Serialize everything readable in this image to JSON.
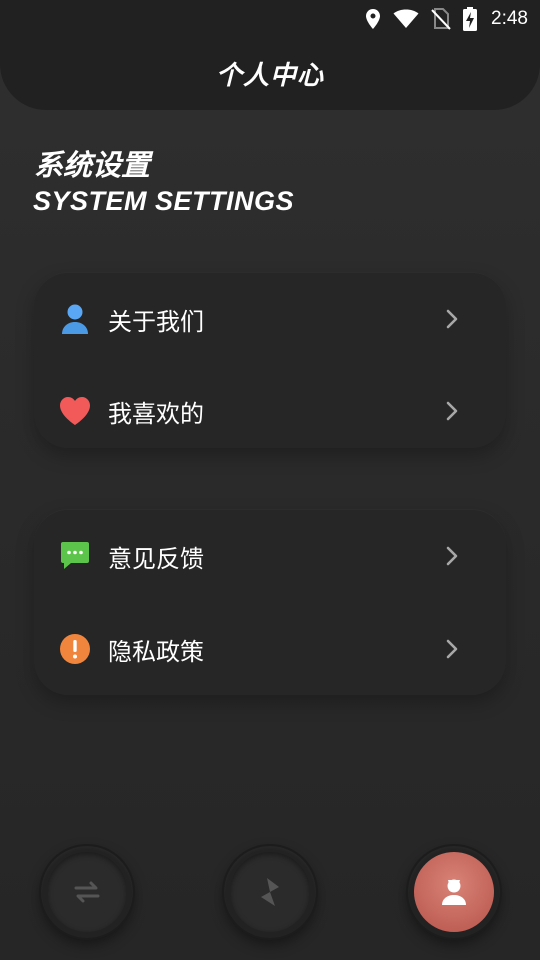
{
  "status_bar": {
    "time": "2:48",
    "icons": [
      "location-icon",
      "wifi-icon",
      "no-sim-icon",
      "battery-charging-icon"
    ]
  },
  "header": {
    "title": "个人中心"
  },
  "section": {
    "title_cn": "系统设置",
    "title_en": "SYSTEM SETTINGS"
  },
  "group1": [
    {
      "label": "关于我们",
      "icon": "user-icon",
      "color": "#5aa8f5"
    },
    {
      "label": "我喜欢的",
      "icon": "heart-icon",
      "color": "#f25a5a"
    }
  ],
  "group2": [
    {
      "label": "意见反馈",
      "icon": "chat-icon",
      "color": "#5cc44a"
    },
    {
      "label": "隐私政策",
      "icon": "warning-icon",
      "color": "#f0853e"
    }
  ],
  "bottom_nav": [
    {
      "icon": "swap-icon",
      "active": false
    },
    {
      "icon": "lightning-icon",
      "active": false
    },
    {
      "icon": "profile-icon",
      "active": true
    }
  ],
  "colors": {
    "accent": "#c96a5f",
    "background": "#2c2c2c",
    "card": "#262626"
  }
}
